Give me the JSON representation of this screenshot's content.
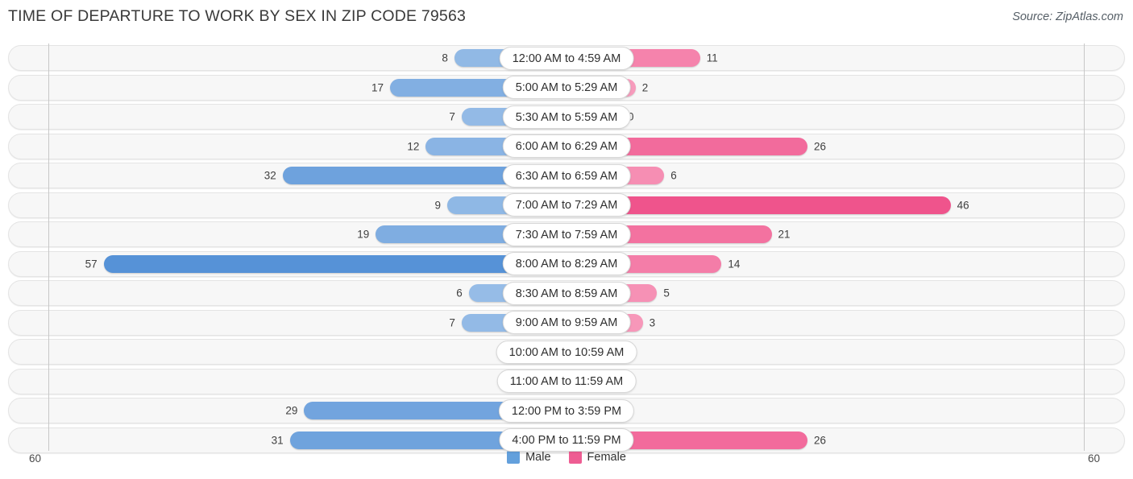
{
  "header": {
    "title": "TIME OF DEPARTURE TO WORK BY SEX IN ZIP CODE 79563",
    "source": "Source: ZipAtlas.com"
  },
  "axis": {
    "left_label": "60",
    "right_label": "60",
    "max": 60
  },
  "legend": {
    "items": [
      {
        "label": "Male",
        "color": "#63a0dc"
      },
      {
        "label": "Female",
        "color": "#ee5d93"
      }
    ]
  },
  "chart_data": {
    "type": "bar",
    "orientation": "horizontal-diverging",
    "title": "TIME OF DEPARTURE TO WORK BY SEX IN ZIP CODE 79563",
    "xlabel": "",
    "ylabel": "",
    "xlim": [
      60,
      0,
      60
    ],
    "grid": false,
    "legend_position": "bottom-center",
    "categories": [
      "12:00 AM to 4:59 AM",
      "5:00 AM to 5:29 AM",
      "5:30 AM to 5:59 AM",
      "6:00 AM to 6:29 AM",
      "6:30 AM to 6:59 AM",
      "7:00 AM to 7:29 AM",
      "7:30 AM to 7:59 AM",
      "8:00 AM to 8:29 AM",
      "8:30 AM to 8:59 AM",
      "9:00 AM to 9:59 AM",
      "10:00 AM to 10:59 AM",
      "11:00 AM to 11:59 AM",
      "12:00 PM to 3:59 PM",
      "4:00 PM to 11:59 PM"
    ],
    "series": [
      {
        "name": "Male",
        "values": [
          8,
          17,
          7,
          12,
          32,
          9,
          19,
          57,
          6,
          7,
          0,
          0,
          29,
          31
        ]
      },
      {
        "name": "Female",
        "values": [
          11,
          2,
          0,
          26,
          6,
          46,
          21,
          14,
          5,
          3,
          0,
          0,
          0,
          26
        ]
      }
    ]
  },
  "rows": [
    {
      "label": "12:00 AM to 4:59 AM",
      "male": "8",
      "female": "11"
    },
    {
      "label": "5:00 AM to 5:29 AM",
      "male": "17",
      "female": "2"
    },
    {
      "label": "5:30 AM to 5:59 AM",
      "male": "7",
      "female": "0"
    },
    {
      "label": "6:00 AM to 6:29 AM",
      "male": "12",
      "female": "26"
    },
    {
      "label": "6:30 AM to 6:59 AM",
      "male": "32",
      "female": "6"
    },
    {
      "label": "7:00 AM to 7:29 AM",
      "male": "9",
      "female": "46"
    },
    {
      "label": "7:30 AM to 7:59 AM",
      "male": "19",
      "female": "21"
    },
    {
      "label": "8:00 AM to 8:29 AM",
      "male": "57",
      "female": "14"
    },
    {
      "label": "8:30 AM to 8:59 AM",
      "male": "6",
      "female": "5"
    },
    {
      "label": "9:00 AM to 9:59 AM",
      "male": "7",
      "female": "3"
    },
    {
      "label": "10:00 AM to 10:59 AM",
      "male": "0",
      "female": "0"
    },
    {
      "label": "11:00 AM to 11:59 AM",
      "male": "0",
      "female": "0"
    },
    {
      "label": "12:00 PM to 3:59 PM",
      "male": "29",
      "female": "0"
    },
    {
      "label": "4:00 PM to 11:59 PM",
      "male": "31",
      "female": "26"
    }
  ]
}
